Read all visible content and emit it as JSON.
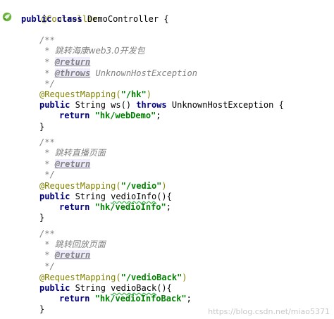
{
  "editor": {
    "class_annotation": "@Controller",
    "class_decl": {
      "kw_public": "public",
      "kw_class": "class",
      "name": " DemoController {"
    },
    "methods": [
      {
        "doc_open": "/**",
        "doc_desc_prefix": " * ",
        "doc_desc": "跳转海康web3.0开发包",
        "tags": [
          {
            "prefix": " * ",
            "tag": "@return",
            "rest": ""
          },
          {
            "prefix": " * ",
            "tag": "@throws",
            "rest": " UnknownHostException"
          }
        ],
        "doc_close": " */",
        "mapping_ann": "@RequestMapping(",
        "mapping_path": "\"/hk\"",
        "mapping_close": ")",
        "sig_public": "public",
        "sig_mid": " String ws() ",
        "sig_throws": "throws",
        "sig_end": " UnknownHostException {",
        "ret_kw": "return",
        "ret_val": "\"hk/webDemo\"",
        "ret_end": ";",
        "close": "}"
      },
      {
        "doc_open": "/**",
        "doc_desc_prefix": " * ",
        "doc_desc": "跳转直播页面",
        "tags": [
          {
            "prefix": " * ",
            "tag": "@return",
            "rest": ""
          }
        ],
        "doc_close": " */",
        "mapping_ann": "@RequestMapping(",
        "mapping_path": "\"/vedio\"",
        "mapping_close": ")",
        "sig_public": "public",
        "sig_mid": " String ",
        "sig_name": "vedioInfo",
        "sig_end": "(){",
        "ret_kw": "return",
        "ret_val": "\"hk/vedioInfo\"",
        "ret_end": ";",
        "close": "}"
      },
      {
        "doc_open": "/**",
        "doc_desc_prefix": " * ",
        "doc_desc": "跳转回放页面",
        "tags": [
          {
            "prefix": " * ",
            "tag": "@return",
            "rest": ""
          }
        ],
        "doc_close": " */",
        "mapping_ann": "@RequestMapping(",
        "mapping_path": "\"/vedioBack\"",
        "mapping_close": ")",
        "sig_public": "public",
        "sig_mid": " String ",
        "sig_name": "vedioBack",
        "sig_end": "(){",
        "ret_kw": "return",
        "ret_val": "\"hk/vedioInfoBack\"",
        "ret_end": ";",
        "close": "}"
      }
    ]
  },
  "watermark": "https://blog.csdn.net/miao5371"
}
